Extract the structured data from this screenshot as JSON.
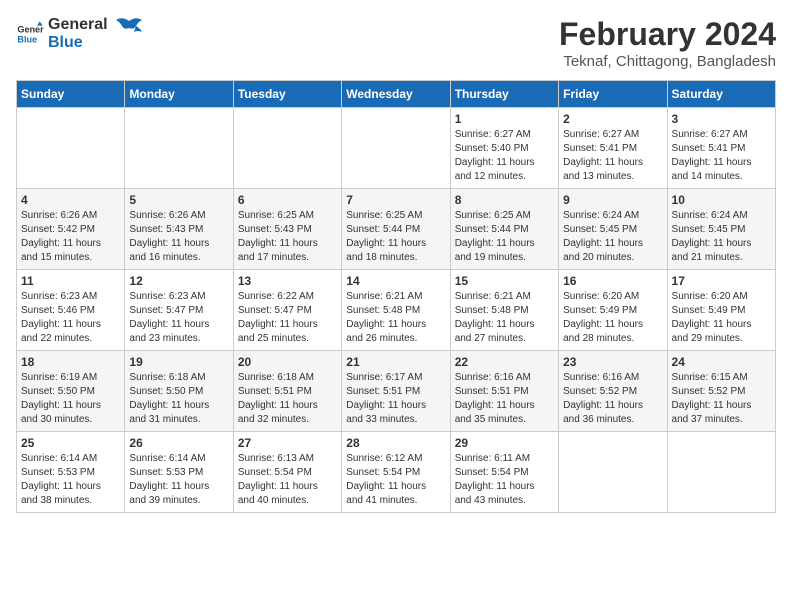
{
  "header": {
    "logo_line1": "General",
    "logo_line2": "Blue",
    "month_year": "February 2024",
    "location": "Teknaf, Chittagong, Bangladesh"
  },
  "days_of_week": [
    "Sunday",
    "Monday",
    "Tuesday",
    "Wednesday",
    "Thursday",
    "Friday",
    "Saturday"
  ],
  "weeks": [
    [
      {
        "num": "",
        "info": ""
      },
      {
        "num": "",
        "info": ""
      },
      {
        "num": "",
        "info": ""
      },
      {
        "num": "",
        "info": ""
      },
      {
        "num": "1",
        "info": "Sunrise: 6:27 AM\nSunset: 5:40 PM\nDaylight: 11 hours\nand 12 minutes."
      },
      {
        "num": "2",
        "info": "Sunrise: 6:27 AM\nSunset: 5:41 PM\nDaylight: 11 hours\nand 13 minutes."
      },
      {
        "num": "3",
        "info": "Sunrise: 6:27 AM\nSunset: 5:41 PM\nDaylight: 11 hours\nand 14 minutes."
      }
    ],
    [
      {
        "num": "4",
        "info": "Sunrise: 6:26 AM\nSunset: 5:42 PM\nDaylight: 11 hours\nand 15 minutes."
      },
      {
        "num": "5",
        "info": "Sunrise: 6:26 AM\nSunset: 5:43 PM\nDaylight: 11 hours\nand 16 minutes."
      },
      {
        "num": "6",
        "info": "Sunrise: 6:25 AM\nSunset: 5:43 PM\nDaylight: 11 hours\nand 17 minutes."
      },
      {
        "num": "7",
        "info": "Sunrise: 6:25 AM\nSunset: 5:44 PM\nDaylight: 11 hours\nand 18 minutes."
      },
      {
        "num": "8",
        "info": "Sunrise: 6:25 AM\nSunset: 5:44 PM\nDaylight: 11 hours\nand 19 minutes."
      },
      {
        "num": "9",
        "info": "Sunrise: 6:24 AM\nSunset: 5:45 PM\nDaylight: 11 hours\nand 20 minutes."
      },
      {
        "num": "10",
        "info": "Sunrise: 6:24 AM\nSunset: 5:45 PM\nDaylight: 11 hours\nand 21 minutes."
      }
    ],
    [
      {
        "num": "11",
        "info": "Sunrise: 6:23 AM\nSunset: 5:46 PM\nDaylight: 11 hours\nand 22 minutes."
      },
      {
        "num": "12",
        "info": "Sunrise: 6:23 AM\nSunset: 5:47 PM\nDaylight: 11 hours\nand 23 minutes."
      },
      {
        "num": "13",
        "info": "Sunrise: 6:22 AM\nSunset: 5:47 PM\nDaylight: 11 hours\nand 25 minutes."
      },
      {
        "num": "14",
        "info": "Sunrise: 6:21 AM\nSunset: 5:48 PM\nDaylight: 11 hours\nand 26 minutes."
      },
      {
        "num": "15",
        "info": "Sunrise: 6:21 AM\nSunset: 5:48 PM\nDaylight: 11 hours\nand 27 minutes."
      },
      {
        "num": "16",
        "info": "Sunrise: 6:20 AM\nSunset: 5:49 PM\nDaylight: 11 hours\nand 28 minutes."
      },
      {
        "num": "17",
        "info": "Sunrise: 6:20 AM\nSunset: 5:49 PM\nDaylight: 11 hours\nand 29 minutes."
      }
    ],
    [
      {
        "num": "18",
        "info": "Sunrise: 6:19 AM\nSunset: 5:50 PM\nDaylight: 11 hours\nand 30 minutes."
      },
      {
        "num": "19",
        "info": "Sunrise: 6:18 AM\nSunset: 5:50 PM\nDaylight: 11 hours\nand 31 minutes."
      },
      {
        "num": "20",
        "info": "Sunrise: 6:18 AM\nSunset: 5:51 PM\nDaylight: 11 hours\nand 32 minutes."
      },
      {
        "num": "21",
        "info": "Sunrise: 6:17 AM\nSunset: 5:51 PM\nDaylight: 11 hours\nand 33 minutes."
      },
      {
        "num": "22",
        "info": "Sunrise: 6:16 AM\nSunset: 5:51 PM\nDaylight: 11 hours\nand 35 minutes."
      },
      {
        "num": "23",
        "info": "Sunrise: 6:16 AM\nSunset: 5:52 PM\nDaylight: 11 hours\nand 36 minutes."
      },
      {
        "num": "24",
        "info": "Sunrise: 6:15 AM\nSunset: 5:52 PM\nDaylight: 11 hours\nand 37 minutes."
      }
    ],
    [
      {
        "num": "25",
        "info": "Sunrise: 6:14 AM\nSunset: 5:53 PM\nDaylight: 11 hours\nand 38 minutes."
      },
      {
        "num": "26",
        "info": "Sunrise: 6:14 AM\nSunset: 5:53 PM\nDaylight: 11 hours\nand 39 minutes."
      },
      {
        "num": "27",
        "info": "Sunrise: 6:13 AM\nSunset: 5:54 PM\nDaylight: 11 hours\nand 40 minutes."
      },
      {
        "num": "28",
        "info": "Sunrise: 6:12 AM\nSunset: 5:54 PM\nDaylight: 11 hours\nand 41 minutes."
      },
      {
        "num": "29",
        "info": "Sunrise: 6:11 AM\nSunset: 5:54 PM\nDaylight: 11 hours\nand 43 minutes."
      },
      {
        "num": "",
        "info": ""
      },
      {
        "num": "",
        "info": ""
      }
    ]
  ]
}
